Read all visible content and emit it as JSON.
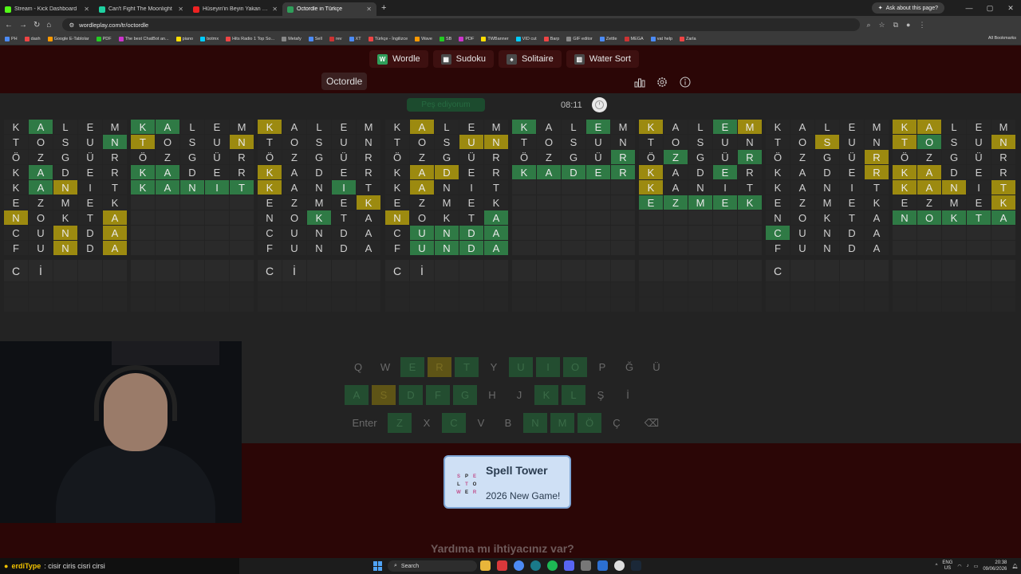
{
  "browser": {
    "tabs": [
      {
        "label": "Stream - Kick Dashboard",
        "color": "#53fc18",
        "active": false
      },
      {
        "label": "Can't Fight The Moonlight",
        "color": "#1fd1a1",
        "active": false
      },
      {
        "label": "Hüseyin'in Beyin Yakan Sorusu! (",
        "color": "#e22",
        "active": false
      },
      {
        "label": "Octordle in Türkçe",
        "color": "#2f9e5a",
        "active": true
      }
    ],
    "new_tab": "+",
    "ask_label": "Ask about this page?",
    "url": "wordleplay.com/tr/octordle",
    "bookmarks": [
      "PH",
      "dash",
      "Google E-Tablolar",
      "PDF",
      "The best ChatBot an...",
      "piano",
      "botmx",
      "Hits Radio 1 Top So...",
      "Metafy",
      "Sell",
      "rev",
      "XT",
      "Türkçe - İngilizce",
      "Wave",
      "SB",
      "PDF",
      "TWBanner",
      "VID cut",
      "Barp",
      "GIF editor",
      "Zettle",
      "MEGA",
      "vat help",
      "Zarla"
    ],
    "all_bookmarks": "All Bookmarks"
  },
  "nav": {
    "games": [
      {
        "label": "Wordle",
        "color": "#2f9e5a",
        "glyph": "W"
      },
      {
        "label": "Sudoku",
        "color": "#4a4a4a",
        "glyph": "▦"
      },
      {
        "label": "Solitaire",
        "color": "#4a4a4a",
        "glyph": "♠"
      },
      {
        "label": "Water Sort",
        "color": "#4a4a4a",
        "glyph": "▥"
      }
    ],
    "title": "Octordle"
  },
  "status": {
    "pill": "Peş ediyorum",
    "timer": "08:11"
  },
  "boards": [
    {
      "rows": [
        {
          "letters": "KALEM",
          "states": "-g---"
        },
        {
          "letters": "TOSUN",
          "states": "----g"
        },
        {
          "letters": "ÖZGÜR",
          "states": "-----"
        },
        {
          "letters": "KADER",
          "states": "-g---"
        },
        {
          "letters": "KANIT",
          "states": "-gy--"
        },
        {
          "letters": "EZMEK",
          "states": "-----"
        },
        {
          "letters": "NOKTA",
          "states": "y---y"
        },
        {
          "letters": "CUNDA",
          "states": "--y-y"
        },
        {
          "letters": "FUNDA",
          "states": "--y-y"
        }
      ],
      "input": [
        "C",
        "İ"
      ]
    },
    {
      "rows": [
        {
          "letters": "KALEM",
          "states": "gg---"
        },
        {
          "letters": "TOSUN",
          "states": "y---y"
        },
        {
          "letters": "ÖZGÜR",
          "states": "-----"
        },
        {
          "letters": "KADER",
          "states": "gg---"
        },
        {
          "letters": "KANIT",
          "states": "ggggg"
        }
      ],
      "input": []
    },
    {
      "rows": [
        {
          "letters": "KALEM",
          "states": "y----"
        },
        {
          "letters": "TOSUN",
          "states": "-----"
        },
        {
          "letters": "ÖZGÜR",
          "states": "-----"
        },
        {
          "letters": "KADER",
          "states": "y----"
        },
        {
          "letters": "KANIT",
          "states": "y--g-"
        },
        {
          "letters": "EZMEK",
          "states": "----y"
        },
        {
          "letters": "NOKTA",
          "states": "--g--"
        },
        {
          "letters": "CUNDA",
          "states": "-----"
        },
        {
          "letters": "FUNDA",
          "states": "-----"
        }
      ],
      "input": [
        "C",
        "İ"
      ]
    },
    {
      "rows": [
        {
          "letters": "KALEM",
          "states": "-y---"
        },
        {
          "letters": "TOSUN",
          "states": "---yy"
        },
        {
          "letters": "ÖZGÜR",
          "states": "-----"
        },
        {
          "letters": "KADER",
          "states": "-yy--"
        },
        {
          "letters": "KANIT",
          "states": "-y---"
        },
        {
          "letters": "EZMEK",
          "states": "-----"
        },
        {
          "letters": "NOKTA",
          "states": "y---g"
        },
        {
          "letters": "CUNDA",
          "states": "-gggg"
        },
        {
          "letters": "FUNDA",
          "states": "-gggg"
        }
      ],
      "input": [
        "C",
        "İ"
      ]
    },
    {
      "rows": [
        {
          "letters": "KALEM",
          "states": "g--g-"
        },
        {
          "letters": "TOSUN",
          "states": "-----"
        },
        {
          "letters": "ÖZGÜR",
          "states": "----g"
        },
        {
          "letters": "KADER",
          "states": "ggggg"
        }
      ],
      "input": []
    },
    {
      "rows": [
        {
          "letters": "KALEM",
          "states": "y--gy"
        },
        {
          "letters": "TOSUN",
          "states": "-----"
        },
        {
          "letters": "ÖZGÜR",
          "states": "-g--g"
        },
        {
          "letters": "KADER",
          "states": "y--g-"
        },
        {
          "letters": "KANIT",
          "states": "y----"
        },
        {
          "letters": "EZMEK",
          "states": "ggggg"
        }
      ],
      "input": []
    },
    {
      "rows": [
        {
          "letters": "KALEM",
          "states": "-----"
        },
        {
          "letters": "TOSUN",
          "states": "--y--"
        },
        {
          "letters": "ÖZGÜR",
          "states": "----y"
        },
        {
          "letters": "KADER",
          "states": "----y"
        },
        {
          "letters": "KANIT",
          "states": "-----"
        },
        {
          "letters": "EZMEK",
          "states": "-----"
        },
        {
          "letters": "NOKTA",
          "states": "-----"
        },
        {
          "letters": "CUNDA",
          "states": "g----"
        },
        {
          "letters": "FUNDA",
          "states": "-----"
        }
      ],
      "input": [
        "C"
      ]
    },
    {
      "rows": [
        {
          "letters": "KALEM",
          "states": "yy---"
        },
        {
          "letters": "TOSUN",
          "states": "yg--y"
        },
        {
          "letters": "ÖZGÜR",
          "states": "-----"
        },
        {
          "letters": "KADER",
          "states": "yy---"
        },
        {
          "letters": "KANIT",
          "states": "yyy-y"
        },
        {
          "letters": "EZMEK",
          "states": "----y"
        },
        {
          "letters": "NOKTA",
          "states": "ggggg"
        }
      ],
      "input": []
    }
  ],
  "keyboard": {
    "row1": [
      {
        "k": "Q",
        "s": ""
      },
      {
        "k": "W",
        "s": ""
      },
      {
        "k": "E",
        "s": "g"
      },
      {
        "k": "R",
        "s": "y"
      },
      {
        "k": "T",
        "s": "g"
      },
      {
        "k": "Y",
        "s": ""
      },
      {
        "k": "U",
        "s": "g"
      },
      {
        "k": "I",
        "s": "g"
      },
      {
        "k": "O",
        "s": "g"
      },
      {
        "k": "P",
        "s": ""
      },
      {
        "k": "Ğ",
        "s": ""
      },
      {
        "k": "Ü",
        "s": ""
      }
    ],
    "row2": [
      {
        "k": "A",
        "s": "g"
      },
      {
        "k": "S",
        "s": "y"
      },
      {
        "k": "D",
        "s": "g"
      },
      {
        "k": "F",
        "s": "g"
      },
      {
        "k": "G",
        "s": "g"
      },
      {
        "k": "H",
        "s": ""
      },
      {
        "k": "J",
        "s": ""
      },
      {
        "k": "K",
        "s": "g"
      },
      {
        "k": "L",
        "s": "g"
      },
      {
        "k": "Ş",
        "s": ""
      },
      {
        "k": "İ",
        "s": ""
      }
    ],
    "row3": [
      {
        "k": "Enter",
        "s": "",
        "wide": true
      },
      {
        "k": "Z",
        "s": "g"
      },
      {
        "k": "X",
        "s": ""
      },
      {
        "k": "C",
        "s": "g"
      },
      {
        "k": "V",
        "s": ""
      },
      {
        "k": "B",
        "s": ""
      },
      {
        "k": "N",
        "s": "g"
      },
      {
        "k": "M",
        "s": "g"
      },
      {
        "k": "Ö",
        "s": "g"
      },
      {
        "k": "Ç",
        "s": ""
      },
      {
        "k": "⌫",
        "s": "",
        "wide": true
      }
    ]
  },
  "promo": {
    "title": "Spell Tower",
    "subtitle": "2026 New Game!",
    "logo_letters": [
      "S",
      "P",
      "E",
      "L",
      "T",
      "O",
      "W",
      "E",
      "R"
    ]
  },
  "help_text": "Yardıma mı ihtiyacınız var?",
  "taskbar": {
    "ticker_user": "erdiType",
    "ticker_text": ": cisir ciris cisri cirsi",
    "search": "Search",
    "lang": "ENG",
    "region": "US",
    "time": "20:38",
    "date": "09/06/2026"
  }
}
